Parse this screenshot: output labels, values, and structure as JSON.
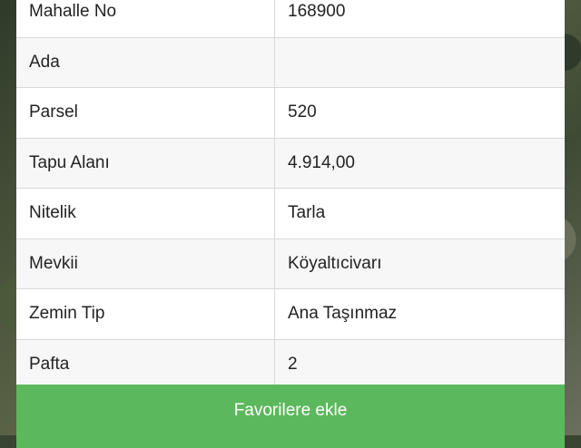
{
  "details": {
    "rows": [
      {
        "label": "Mahalle No",
        "value": "168900"
      },
      {
        "label": "Ada",
        "value": ""
      },
      {
        "label": "Parsel",
        "value": "520"
      },
      {
        "label": "Tapu Alanı",
        "value": "4.914,00"
      },
      {
        "label": "Nitelik",
        "value": "Tarla"
      },
      {
        "label": "Mevkii",
        "value": "Köyaltıcivarı"
      },
      {
        "label": "Zemin Tip",
        "value": "Ana Taşınmaz"
      },
      {
        "label": "Pafta",
        "value": "2"
      }
    ]
  },
  "actions": {
    "favorite_label": "Favorilere ekle",
    "favorite_color": "#5cb85c"
  }
}
